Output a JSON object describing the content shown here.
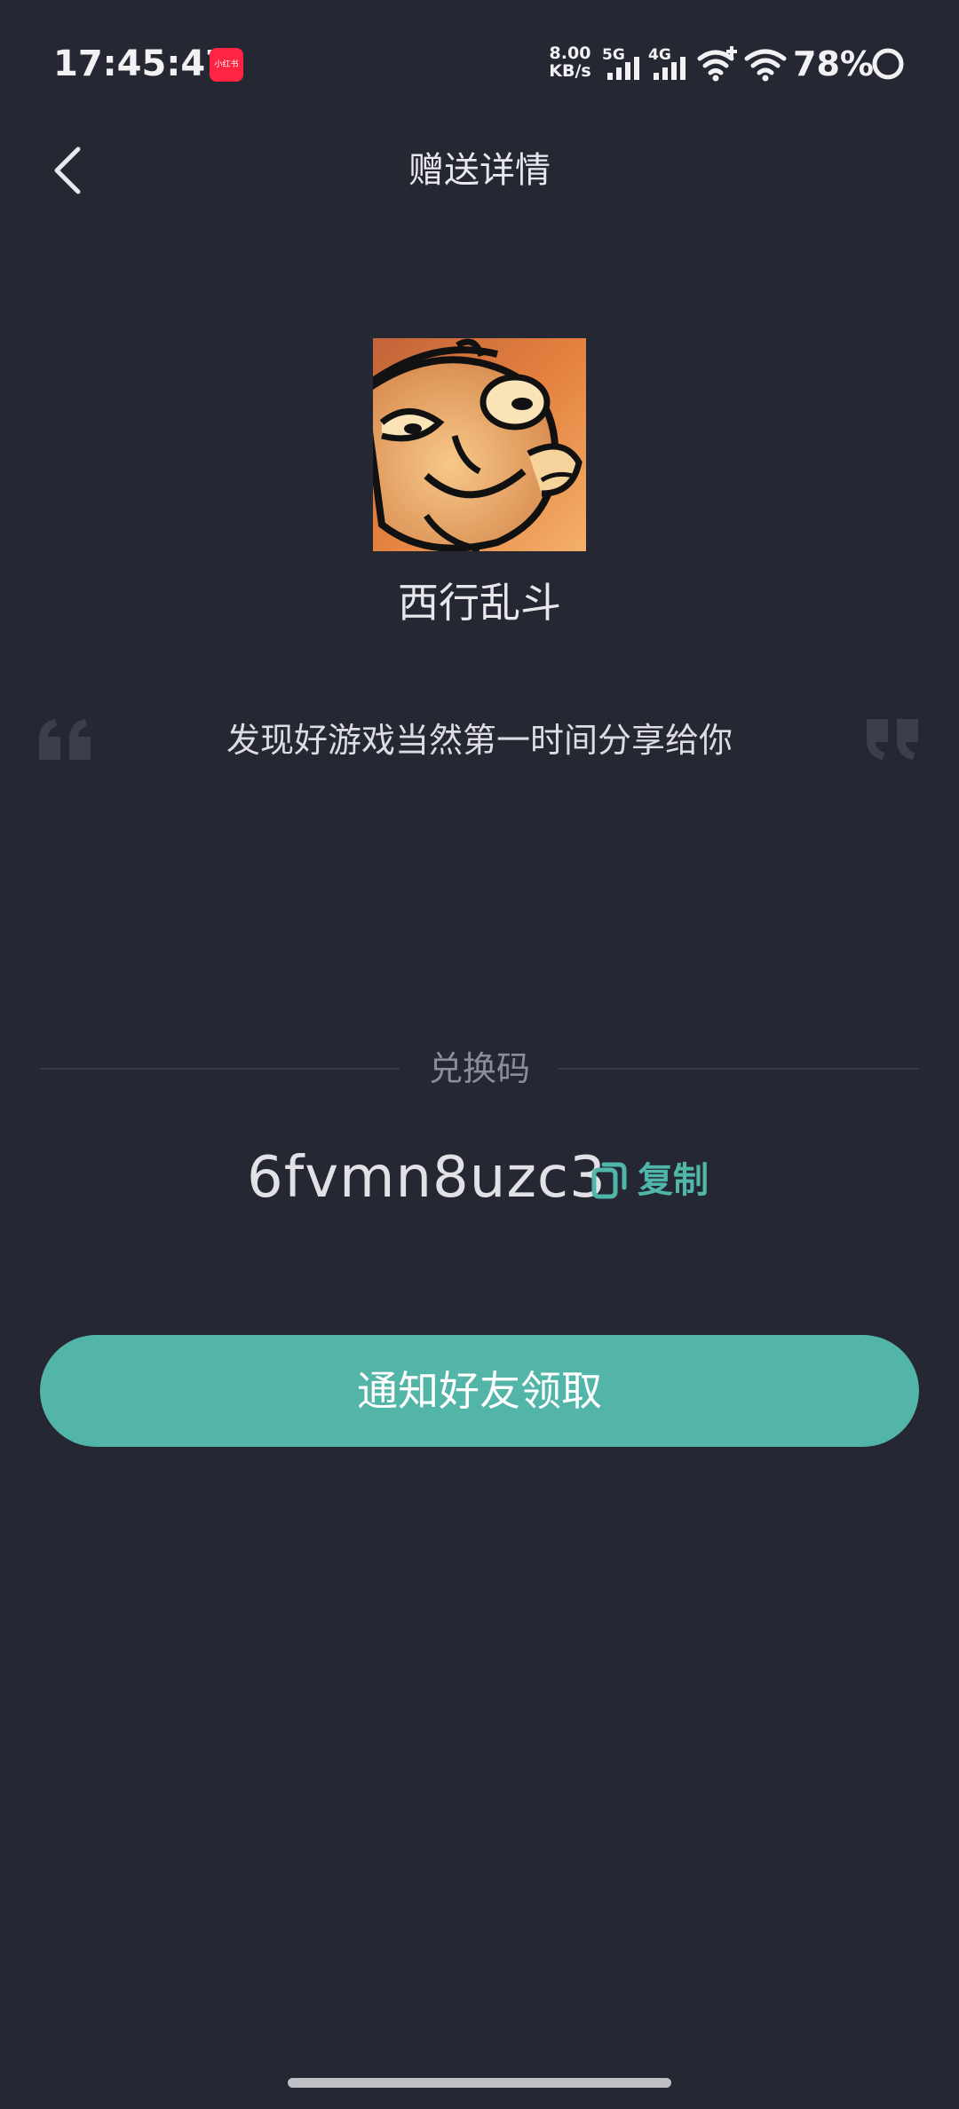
{
  "status_bar": {
    "time": "17:45:47",
    "app_badge_text": "小红书",
    "net_speed_value": "8.00",
    "net_speed_unit": "KB/s",
    "sim1_label": "5G",
    "sim2_label": "4G",
    "battery": "78%",
    "icons": [
      "signal-5g-icon",
      "signal-4g-icon",
      "wifi-plus-icon",
      "wifi-icon",
      "battery-ring-icon"
    ]
  },
  "header": {
    "title": "赠送详情",
    "back_icon": "chevron-left-icon"
  },
  "game": {
    "name": "西行乱斗",
    "icon": "game-cover-image"
  },
  "message": {
    "text": "发现好游戏当然第一时间分享给你"
  },
  "redeem": {
    "label": "兑换码",
    "code": "6fvmn8uzc3",
    "copy_label": "复制",
    "copy_icon": "copy-icon"
  },
  "primary_action": {
    "label": "通知好友领取"
  },
  "colors": {
    "background": "#252733",
    "accent": "#52b5a8",
    "accent_text": "#4fb6a8",
    "muted_text": "#8a8e99"
  }
}
